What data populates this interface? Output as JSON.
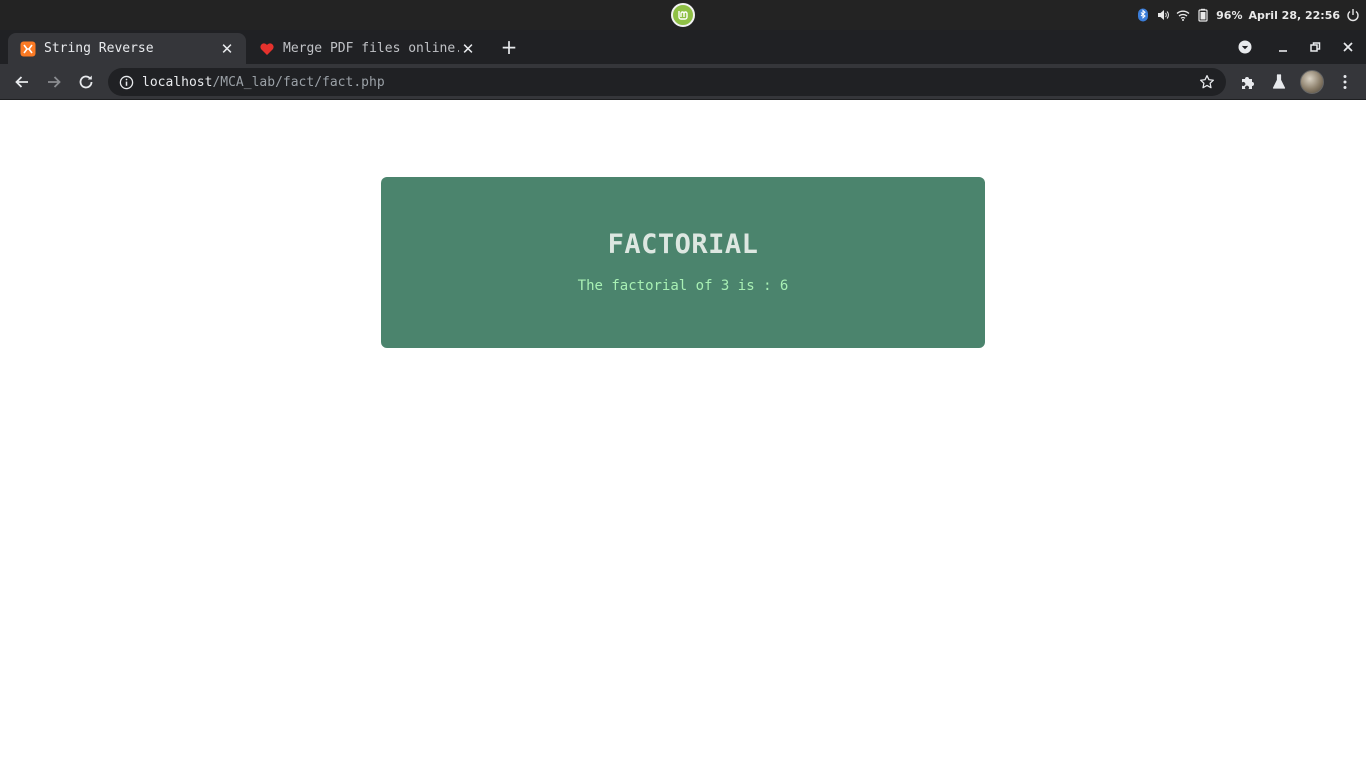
{
  "system_panel": {
    "battery": "96%",
    "clock": "April 28, 22:56"
  },
  "browser": {
    "tabs": [
      {
        "title": "String Reverse",
        "active": true,
        "favicon": "xampp-icon"
      },
      {
        "title": "Merge PDF files online.",
        "active": false,
        "favicon": "heart-icon"
      }
    ],
    "address": {
      "host": "localhost",
      "path": "/MCA_lab/fact/fact.php"
    }
  },
  "page": {
    "heading": "FACTORIAL",
    "result": "The factorial of 3 is : 6",
    "colors": {
      "card_bg": "#4b846d",
      "heading": "#dde7e1",
      "result": "#a8f0b4"
    }
  }
}
